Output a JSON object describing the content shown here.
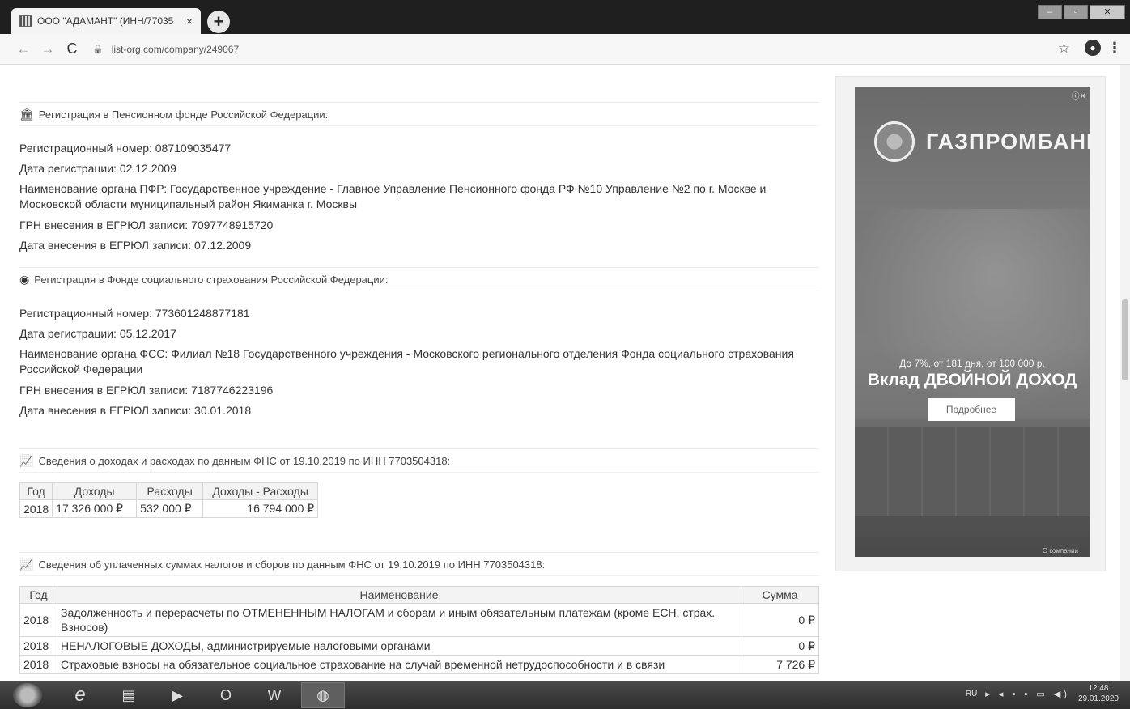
{
  "browser": {
    "tab_title": "ООО \"АДАМАНТ\" (ИНН/77035",
    "tab_close": "×",
    "new_tab": "+",
    "url": "list-org.com/company/249067",
    "minimize": "–",
    "maximize": "▫",
    "close": "✕",
    "back_icon": "←",
    "forward_icon": "→",
    "reload_icon": "C",
    "lock_icon": "🔒",
    "star_icon": "☆",
    "menu_icon": "⋮"
  },
  "pfr": {
    "heading": "Регистрация в Пенсионном фонде Российской Федерации:",
    "icon": "🏛",
    "lines": [
      "Регистрационный номер: 087109035477",
      "Дата регистрации: 02.12.2009",
      "Наименование органа ПФР: Государственное учреждение - Главное Управление Пенсионного фонда РФ №10 Управление №2 по г. Москве и Московской области муниципальный район Якиманка г. Москвы",
      "ГРН внесения в ЕГРЮЛ записи: 7097748915720",
      "Дата внесения в ЕГРЮЛ записи: 07.12.2009"
    ]
  },
  "fss": {
    "heading": "Регистрация в Фонде социального страхования Российской Федерации:",
    "icon": "◉",
    "lines": [
      "Регистрационный номер: 773601248877181",
      "Дата регистрации: 05.12.2017",
      "Наименование органа ФСС: Филиал №18 Государственного учреждения - Московского регионального отделения Фонда социального страхования Российской Федерации",
      "ГРН внесения в ЕГРЮЛ записи: 7187746223196",
      "Дата внесения в ЕГРЮЛ записи: 30.01.2018"
    ]
  },
  "income": {
    "heading": "Сведения о доходах и расходах по данным ФНС от 19.10.2019 по ИНН 7703504318:",
    "icon": "📈",
    "headers": [
      "Год",
      "Доходы",
      "Расходы",
      "Доходы - Расходы"
    ],
    "rows": [
      [
        "2018",
        "17 326 000 ₽",
        "532 000 ₽",
        "16 794 000 ₽"
      ]
    ]
  },
  "taxes": {
    "heading": "Сведения об уплаченных суммах налогов и сборов по данным ФНС от 19.10.2019 по ИНН 7703504318:",
    "icon": "📈",
    "headers": [
      "Год",
      "Наименование",
      "Сумма"
    ],
    "rows": [
      [
        "2018",
        "Задолженность и перерасчеты по ОТМЕНЕННЫМ НАЛОГАМ и сборам и иным обязательным платежам (кроме ЕСН, страх. Взносов)",
        "0 ₽"
      ],
      [
        "2018",
        "НЕНАЛОГОВЫЕ ДОХОДЫ, администрируемые налоговыми органами",
        "0 ₽"
      ],
      [
        "2018",
        "Страховые взносы на обязательное социальное страхование на случай временной нетрудоспособности и в связи",
        "7 726 ₽"
      ]
    ]
  },
  "ad": {
    "close": "ⓘ✕",
    "brand": "ГАЗПРОМБАНК",
    "small_text": "До 7%, от 181 дня, от 100 000 р.",
    "headline": "Вклад ДВОЙНОЙ ДОХОД",
    "button": "Подробнее",
    "footer": "О компании"
  },
  "taskbar": {
    "apps": [
      "e",
      "▤",
      "▶",
      "O",
      "W",
      "◍"
    ],
    "lang": "RU",
    "tray_icons": "▸ ◂ ▪ ▪ ▭ ◀)",
    "time": "12:48",
    "date": "29.01.2020"
  }
}
